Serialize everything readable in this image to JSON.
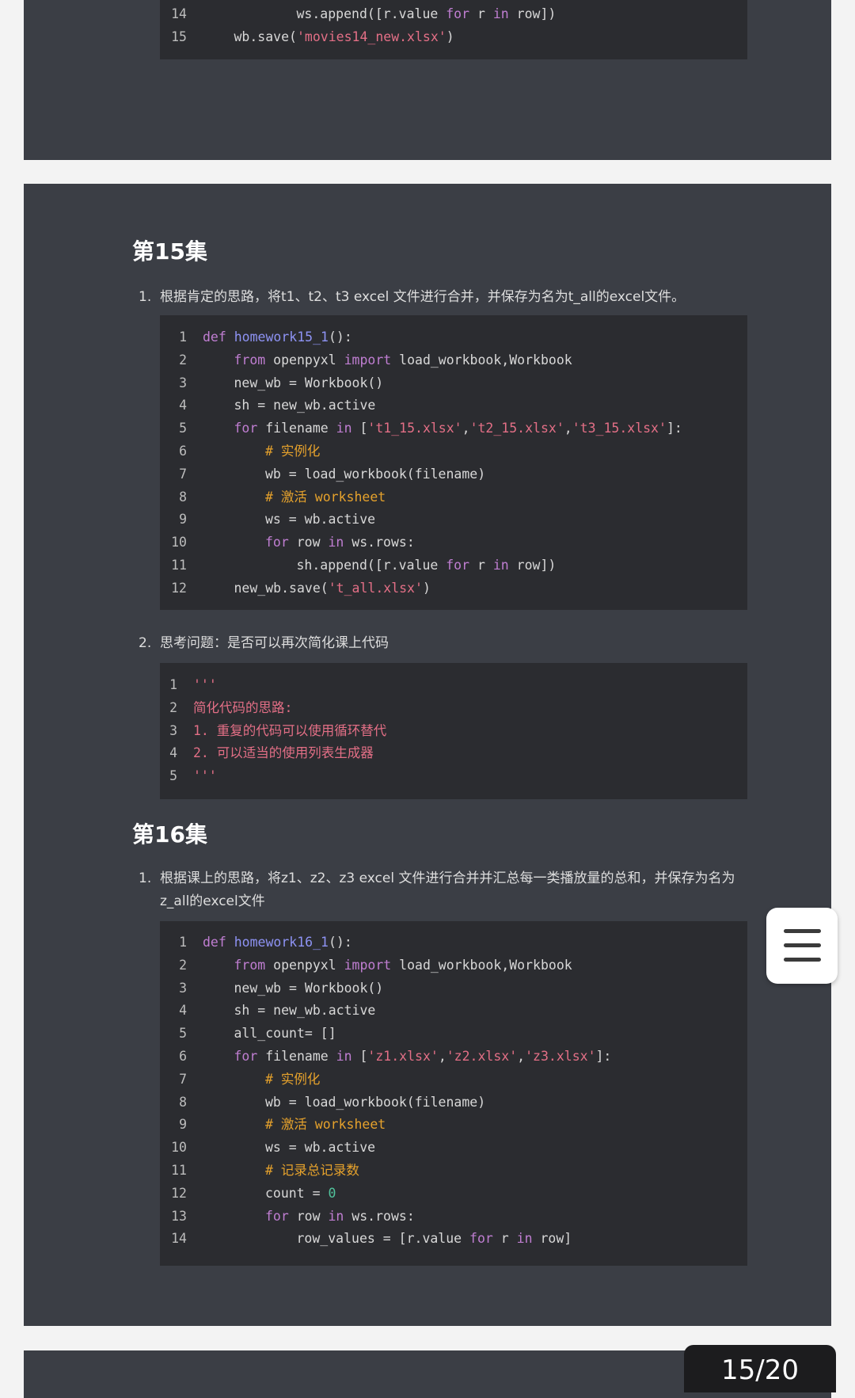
{
  "top_block": {
    "lines": [
      {
        "n": "14",
        "indent": 3,
        "tokens": [
          [
            "p",
            "ws.append([r.value "
          ],
          [
            "kw",
            "for"
          ],
          [
            "p",
            " r "
          ],
          [
            "kw",
            "in"
          ],
          [
            "p",
            " row])"
          ]
        ]
      },
      {
        "n": "15",
        "indent": 1,
        "tokens": [
          [
            "p",
            "wb.save("
          ],
          [
            "str",
            "'movies14_new.xlsx'"
          ],
          [
            "p",
            ")"
          ]
        ]
      }
    ]
  },
  "sections": [
    {
      "heading": "第15集",
      "items": [
        {
          "number": "1.",
          "text": "根据肯定的思路，将t1、t2、t3 excel 文件进行合并，并保存为名为t_all的excel文件。",
          "code": [
            {
              "n": "1",
              "indent": 0,
              "tokens": [
                [
                  "kw",
                  "def"
                ],
                [
                  "p",
                  " "
                ],
                [
                  "fn",
                  "homework15_1"
                ],
                [
                  "p",
                  "():"
                ]
              ]
            },
            {
              "n": "2",
              "indent": 1,
              "tokens": [
                [
                  "kw",
                  "from"
                ],
                [
                  "p",
                  " openpyxl "
                ],
                [
                  "kw",
                  "import"
                ],
                [
                  "p",
                  " load_workbook,Workbook"
                ]
              ]
            },
            {
              "n": "3",
              "indent": 1,
              "tokens": [
                [
                  "p",
                  "new_wb = Workbook()"
                ]
              ]
            },
            {
              "n": "4",
              "indent": 1,
              "tokens": [
                [
                  "p",
                  "sh = new_wb.active"
                ]
              ]
            },
            {
              "n": "5",
              "indent": 1,
              "tokens": [
                [
                  "kw",
                  "for"
                ],
                [
                  "p",
                  " filename "
                ],
                [
                  "kw",
                  "in"
                ],
                [
                  "p",
                  " ["
                ],
                [
                  "str",
                  "'t1_15.xlsx'"
                ],
                [
                  "p",
                  ","
                ],
                [
                  "str",
                  "'t2_15.xlsx'"
                ],
                [
                  "p",
                  ","
                ],
                [
                  "str",
                  "'t3_15.xlsx'"
                ],
                [
                  "p",
                  "]:"
                ]
              ]
            },
            {
              "n": "6",
              "indent": 2,
              "tokens": [
                [
                  "cm",
                  "# 实例化"
                ]
              ]
            },
            {
              "n": "7",
              "indent": 2,
              "tokens": [
                [
                  "p",
                  "wb = load_workbook(filename)"
                ]
              ]
            },
            {
              "n": "8",
              "indent": 2,
              "tokens": [
                [
                  "cm",
                  "# 激活 worksheet"
                ]
              ]
            },
            {
              "n": "9",
              "indent": 2,
              "tokens": [
                [
                  "p",
                  "ws = wb.active"
                ]
              ]
            },
            {
              "n": "10",
              "indent": 2,
              "tokens": [
                [
                  "kw",
                  "for"
                ],
                [
                  "p",
                  " row "
                ],
                [
                  "kw",
                  "in"
                ],
                [
                  "p",
                  " ws.rows:"
                ]
              ]
            },
            {
              "n": "11",
              "indent": 3,
              "tokens": [
                [
                  "p",
                  "sh.append([r.value "
                ],
                [
                  "kw",
                  "for"
                ],
                [
                  "p",
                  " r "
                ],
                [
                  "kw",
                  "in"
                ],
                [
                  "p",
                  " row])"
                ]
              ]
            },
            {
              "n": "12",
              "indent": 1,
              "tokens": [
                [
                  "p",
                  "new_wb.save("
                ],
                [
                  "str",
                  "'t_all.xlsx'"
                ],
                [
                  "p",
                  ")"
                ]
              ]
            }
          ]
        },
        {
          "number": "2.",
          "text": "思考问题：是否可以再次简化课上代码",
          "code": [
            {
              "n": "1",
              "indent": 0,
              "tokens": [
                [
                  "str",
                  "'''"
                ]
              ]
            },
            {
              "n": "2",
              "indent": 0,
              "tokens": [
                [
                  "str",
                  "简化代码的思路:"
                ]
              ]
            },
            {
              "n": "3",
              "indent": 0,
              "tokens": [
                [
                  "str",
                  "1. 重复的代码可以使用循环替代"
                ]
              ]
            },
            {
              "n": "4",
              "indent": 0,
              "tokens": [
                [
                  "str",
                  "2. 可以适当的使用列表生成器"
                ]
              ]
            },
            {
              "n": "5",
              "indent": 0,
              "tokens": [
                [
                  "str",
                  "'''"
                ]
              ]
            }
          ]
        }
      ]
    },
    {
      "heading": "第16集",
      "items": [
        {
          "number": "1.",
          "text": "根据课上的思路，将z1、z2、z3 excel 文件进行合并并汇总每一类播放量的总和，并保存为名为z_all的excel文件",
          "code": [
            {
              "n": "1",
              "indent": 0,
              "tokens": [
                [
                  "kw",
                  "def"
                ],
                [
                  "p",
                  " "
                ],
                [
                  "fn",
                  "homework16_1"
                ],
                [
                  "p",
                  "():"
                ]
              ]
            },
            {
              "n": "2",
              "indent": 1,
              "tokens": [
                [
                  "kw",
                  "from"
                ],
                [
                  "p",
                  " openpyxl "
                ],
                [
                  "kw",
                  "import"
                ],
                [
                  "p",
                  " load_workbook,Workbook"
                ]
              ]
            },
            {
              "n": "3",
              "indent": 1,
              "tokens": [
                [
                  "p",
                  "new_wb = Workbook()"
                ]
              ]
            },
            {
              "n": "4",
              "indent": 1,
              "tokens": [
                [
                  "p",
                  "sh = new_wb.active"
                ]
              ]
            },
            {
              "n": "5",
              "indent": 1,
              "tokens": [
                [
                  "p",
                  "all_count= []"
                ]
              ]
            },
            {
              "n": "6",
              "indent": 1,
              "tokens": [
                [
                  "kw",
                  "for"
                ],
                [
                  "p",
                  " filename "
                ],
                [
                  "kw",
                  "in"
                ],
                [
                  "p",
                  " ["
                ],
                [
                  "str",
                  "'z1.xlsx'"
                ],
                [
                  "p",
                  ","
                ],
                [
                  "str",
                  "'z2.xlsx'"
                ],
                [
                  "p",
                  ","
                ],
                [
                  "str",
                  "'z3.xlsx'"
                ],
                [
                  "p",
                  "]:"
                ]
              ]
            },
            {
              "n": "7",
              "indent": 2,
              "tokens": [
                [
                  "cm",
                  "# 实例化"
                ]
              ]
            },
            {
              "n": "8",
              "indent": 2,
              "tokens": [
                [
                  "p",
                  "wb = load_workbook(filename)"
                ]
              ]
            },
            {
              "n": "9",
              "indent": 2,
              "tokens": [
                [
                  "cm",
                  "# 激活 worksheet"
                ]
              ]
            },
            {
              "n": "10",
              "indent": 2,
              "tokens": [
                [
                  "p",
                  "ws = wb.active"
                ]
              ]
            },
            {
              "n": "11",
              "indent": 2,
              "tokens": [
                [
                  "cm",
                  "# 记录总记录数"
                ]
              ]
            },
            {
              "n": "12",
              "indent": 2,
              "tokens": [
                [
                  "p",
                  "count = "
                ],
                [
                  "num",
                  "0"
                ]
              ]
            },
            {
              "n": "13",
              "indent": 2,
              "tokens": [
                [
                  "kw",
                  "for"
                ],
                [
                  "p",
                  " row "
                ],
                [
                  "kw",
                  "in"
                ],
                [
                  "p",
                  " ws.rows:"
                ]
              ]
            },
            {
              "n": "14",
              "indent": 3,
              "tokens": [
                [
                  "p",
                  "row_values = [r.value "
                ],
                [
                  "kw",
                  "for"
                ],
                [
                  "p",
                  " r "
                ],
                [
                  "kw",
                  "in"
                ],
                [
                  "p",
                  " row]"
                ]
              ]
            }
          ]
        }
      ]
    }
  ],
  "menu_button": {
    "icon": "hamburger-menu-icon"
  },
  "page_indicator": "15/20",
  "colors": {
    "panel_bg": "#3b3e45",
    "code_bg": "#2b2c30",
    "keyword": "#c07ed2",
    "function_name": "#8e93f4",
    "string": "#e36f86",
    "comment": "#e6a22c",
    "number": "#51c29b"
  }
}
